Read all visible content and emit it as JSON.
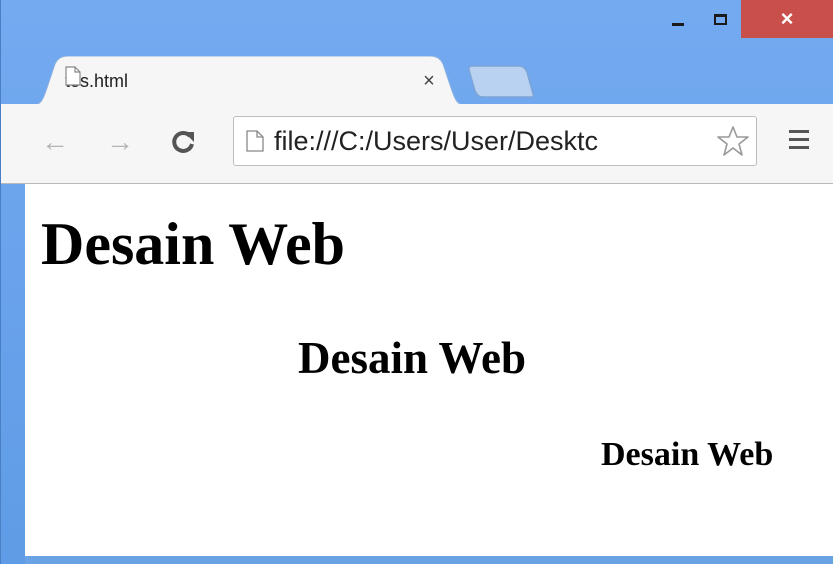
{
  "window": {
    "controls": {
      "minimize": "minimize-icon",
      "maximize": "maximize-icon",
      "close": "×"
    }
  },
  "tab": {
    "title": "tes.html",
    "close_label": "×",
    "icon": "page-icon"
  },
  "toolbar": {
    "back_glyph": "←",
    "forward_glyph": "→",
    "reload_glyph": "C",
    "url": "file:///C:/Users/User/Desktc",
    "star_icon": "star-icon",
    "menu_icon": "menu-icon"
  },
  "page": {
    "heading_left": "Desain Web",
    "heading_center": "Desain Web",
    "heading_right": "Desain Web"
  },
  "colors": {
    "frame": "#6aa2e6",
    "close_button": "#c9504a",
    "toolbar": "#f6f6f6",
    "content_bg": "#ffffff"
  }
}
